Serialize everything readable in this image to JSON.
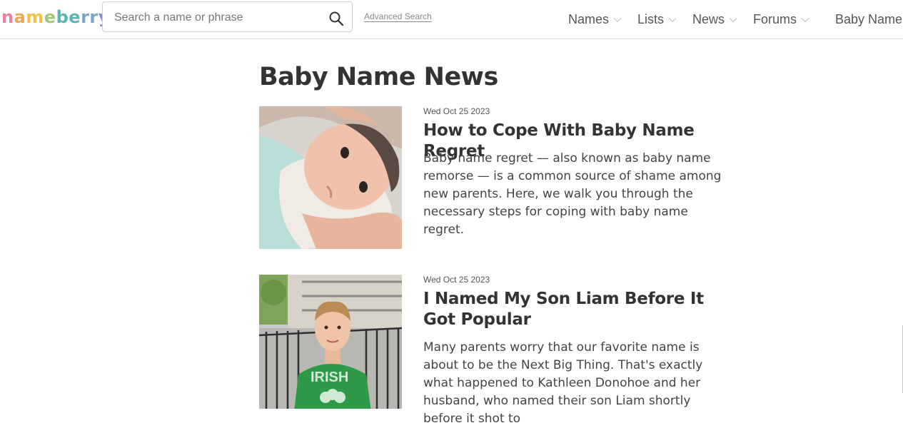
{
  "logo": {
    "letters": [
      "n",
      "a",
      "m",
      "e",
      "b",
      "e",
      "r",
      "r",
      "y"
    ],
    "colors": [
      "#e8829a",
      "#f2a65a",
      "#f0c24a",
      "#9cc97a",
      "#5fb3b3",
      "#5fb3b3",
      "#7aa5c9",
      "#7aa5c9",
      "#8a8fc9"
    ]
  },
  "search": {
    "placeholder": "Search a name or phrase",
    "value": ""
  },
  "advanced_search": "Advanced Search",
  "nav": {
    "items": [
      "Names",
      "Lists",
      "News",
      "Forums"
    ],
    "last": "Baby Name"
  },
  "page_title": "Baby Name News",
  "articles": [
    {
      "date": "Wed Oct 25 2023",
      "title": "How to Cope With Baby Name Regret",
      "summary": "Baby name regret — also known as baby name remorse — is a common source of shame among new parents. Here, we walk you through the necessary steps for coping with baby name regret."
    },
    {
      "date": "Wed Oct 25 2023",
      "title": "I Named My Son Liam Before It Got Popular",
      "summary": "Many parents worry that our favorite name is about to be the Next Big Thing. That's exactly what happened to Kathleen Donohoe and her husband, who named their son Liam shortly before it shot to"
    }
  ],
  "icons": {
    "search": "search-icon",
    "chevron": "chevron-down-icon"
  },
  "colors": {
    "text": "#333333",
    "nav_text": "#555555",
    "border": "#dcdcdc"
  }
}
